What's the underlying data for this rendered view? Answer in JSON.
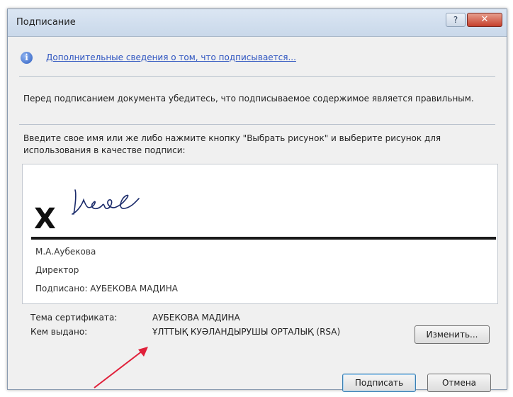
{
  "window": {
    "title": "Подписание",
    "help_label": "?",
    "close_label": "✕"
  },
  "info": {
    "icon": "info-icon",
    "link_text": "Дополнительные сведения о том, что подписывается..."
  },
  "instructions": {
    "verify_text": "Перед подписанием документа убедитесь, что подписываемое содержимое является правильным.",
    "enter_text": "Введите свое имя или же либо нажмите кнопку \"Выбрать рисунок\" и выберите рисунок для использования в качестве подписи:"
  },
  "signature": {
    "x_mark": "X",
    "name": "М.А.Аубекова",
    "position": "Директор",
    "signed_by": "Подписано: АУБЕКОВА МАДИНА"
  },
  "certificate": {
    "subject_label": "Тема сертификата:",
    "subject_value": "АУБЕКОВА МАДИНА",
    "issuer_label": "Кем выдано:",
    "issuer_value": "ҰЛТТЫҚ КУӘЛАНДЫРУШЫ ОРТАЛЫҚ (RSA)"
  },
  "buttons": {
    "change": "Изменить...",
    "sign": "Подписать",
    "cancel": "Отмена"
  },
  "colors": {
    "link": "#2d54c0",
    "close": "#c5402c",
    "arrow": "#e0203a"
  }
}
